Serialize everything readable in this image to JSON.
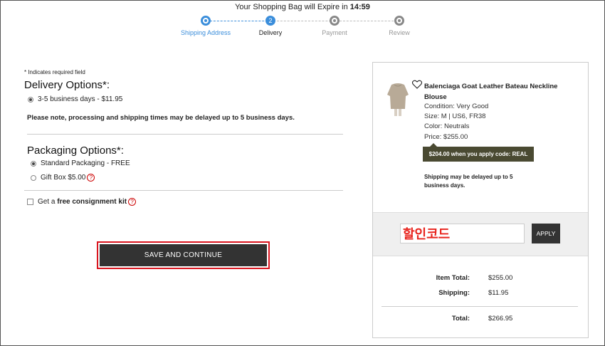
{
  "header": {
    "expire_prefix": "Your Shopping Bag will Expire in ",
    "expire_time": "14:59"
  },
  "steps": [
    {
      "label": "Shipping Address",
      "number": "",
      "state": "done"
    },
    {
      "label": "Delivery",
      "number": "2",
      "state": "active"
    },
    {
      "label": "Payment",
      "number": "",
      "state": "todo"
    },
    {
      "label": "Review",
      "number": "",
      "state": "todo"
    }
  ],
  "form": {
    "required_note": "* Indicates required field",
    "delivery_title": "Delivery Options*:",
    "delivery_option": "3-5 business days - $11.95",
    "delay_note": "Please note, processing and shipping times may be delayed up to 5 business days.",
    "packaging_title": "Packaging Options*:",
    "packaging_standard": "Standard Packaging - FREE",
    "packaging_giftbox": "Gift Box $5.00",
    "kit_prefix": "Get a ",
    "kit_bold": "free consignment kit",
    "help_glyph": "?",
    "save_label": "SAVE AND CONTINUE"
  },
  "product": {
    "name": "Balenciaga Goat Leather Bateau Neckline Blouse",
    "condition": "Condition: Very Good",
    "size": "Size: M | US6, FR38",
    "color": "Color: Neutrals",
    "price": "Price: $255.00",
    "promo": "$204.00 when you apply code: REAL",
    "shipping_note": "Shipping may be delayed up to 5 business days.",
    "thumb_icon": "blouse-image",
    "wishlist_icon": "heart-icon"
  },
  "promo_code": {
    "value": "할인코드",
    "apply_label": "APPLY"
  },
  "totals": {
    "item_total_label": "Item Total:",
    "item_total_value": "$255.00",
    "shipping_label": "Shipping:",
    "shipping_value": "$11.95",
    "total_label": "Total:",
    "total_value": "$266.95"
  },
  "colors": {
    "accent_blue": "#3b8edb",
    "button_dark": "#333333",
    "highlight_red": "#d9141e",
    "promo_bg": "#4a4a32"
  }
}
